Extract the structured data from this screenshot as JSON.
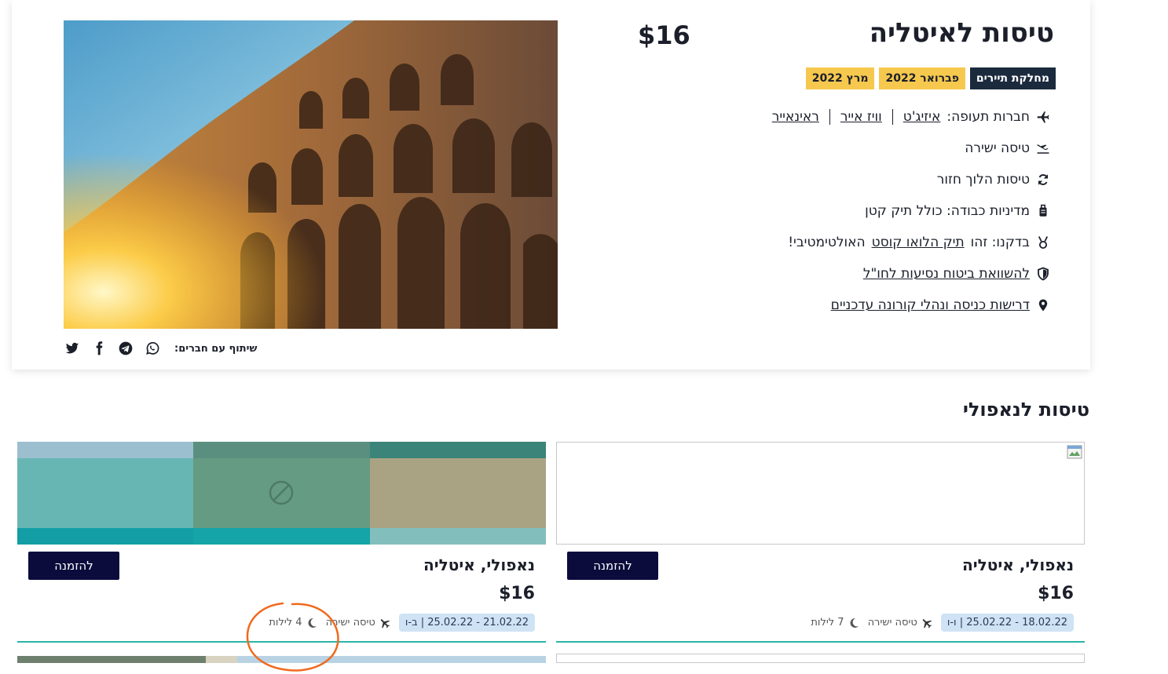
{
  "hero": {
    "title": "טיסות לאיטליה",
    "price": "$16",
    "tags": [
      {
        "label": "מחלקת תיירים",
        "style": "dark"
      },
      {
        "label": "פברואר 2022",
        "style": "yellow"
      },
      {
        "label": "מרץ 2022",
        "style": "yellow"
      }
    ],
    "features": {
      "airlines_label": "חברות תעופה:",
      "airlines": [
        "איזיג'ט",
        "וויז אייר",
        "ראינאייר"
      ],
      "direct": "טיסה ישירה",
      "round_trip": "טיסות הלוך חזור",
      "baggage": "מדיניות כבודה: כולל תיק קטן",
      "checked_prefix": "בדקנו: זהו",
      "checked_link": "תיק הלואו קוסט",
      "checked_suffix": "האולטימטיבי!",
      "insurance": "להשוואת ביטוח נסיעות לחו\"ל",
      "entry": "דרישות כניסה ונהלי קורונה עדכניים"
    },
    "share_label": "שיתוף עם חברים:",
    "share_icons": [
      "whatsapp-icon",
      "telegram-icon",
      "facebook-icon",
      "twitter-icon"
    ]
  },
  "section": {
    "title": "טיסות לנאפולי"
  },
  "deals": [
    {
      "name": "נאפולי, איטליה",
      "price": "$16",
      "dates": "18.02.22 - 25.02.22 | ו-ו",
      "flight_type": "טיסה ישירה",
      "nights": "7 לילות",
      "book_label": "להזמנה",
      "image": "broken"
    },
    {
      "name": "נאפולי, איטליה",
      "price": "$16",
      "dates": "21.02.22 - 25.02.22 | ב-ו",
      "flight_type": "טיסה ישירה",
      "nights": "4 לילות",
      "book_label": "להזמנה",
      "image": "placeholder-tiles"
    }
  ],
  "colors": {
    "dark_tag": "#1c2a3e",
    "yellow_tag": "#f6c84e",
    "button": "#0b0c3c",
    "date_pill": "#cfe3f5",
    "divider": "#2bb5a5",
    "annotation": "#f06a1e"
  }
}
